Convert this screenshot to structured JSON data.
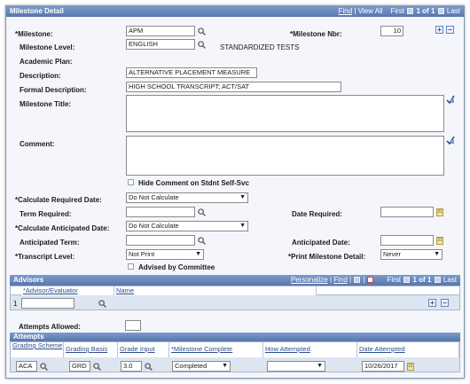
{
  "milestone_detail": {
    "title": "Milestone Detail",
    "nav": {
      "find": "Find",
      "view_all": "View All",
      "first": "First",
      "count": "1 of 1",
      "last": "Last",
      "sep": "|"
    },
    "milestone_label": "*Milestone:",
    "milestone_value": "APM",
    "milestone_nbr_label": "*Milestone Nbr:",
    "milestone_nbr_value": "10",
    "milestone_level_label": "Milestone Level:",
    "milestone_level_value": "ENGLISH",
    "milestone_level_desc": "STANDARDIZED TESTS",
    "academic_plan_label": "Academic Plan:",
    "description_label": "Description:",
    "description_value": "ALTERNATIVE PLACEMENT MEASURE",
    "formal_description_label": "Formal Description:",
    "formal_description_value": "HIGH SCHOOL TRANSCRIPT; ACT/SAT",
    "milestone_title_label": "Milestone Title:",
    "comment_label": "Comment:",
    "hide_comment_label": "Hide Comment on Stdnt Self-Svc",
    "calc_required_label": "*Calculate Required Date:",
    "calc_required_value": "Do Not Calculate",
    "term_required_label": "Term Required:",
    "date_required_label": "Date Required:",
    "calc_anticipated_label": "*Calculate Anticipated Date:",
    "calc_anticipated_value": "Do Not Calculate",
    "anticipated_term_label": "Anticipated Term:",
    "anticipated_date_label": "Anticipated Date:",
    "transcript_level_label": "*Transcript Level:",
    "transcript_level_value": "Not Print",
    "print_detail_label": "*Print Milestone Detail:",
    "print_detail_value": "Never",
    "advised_label": "Advised by Committee"
  },
  "advisors": {
    "title": "Advisors",
    "nav": {
      "personalize": "Personalize",
      "find": "Find",
      "first": "First",
      "count": "1 of 1",
      "last": "Last",
      "sep": "|"
    },
    "col_advisor": "*Advisor/Evaluator",
    "col_name": "Name",
    "row_num": "1"
  },
  "attempts_allowed_label": "Attempts Allowed:",
  "attempts": {
    "title": "Attempts",
    "col_grading_scheme": "Grading Scheme",
    "col_grading_basis": "Grading Basis",
    "col_grade_input": "Grade Input",
    "col_milestone_complete": "*Milestone Complete",
    "col_how_attempted": "How Attempted",
    "col_date_attempted": "Date Attempted",
    "grading_scheme": "ACA",
    "grading_basis": "GRD",
    "grade_input": "3.0",
    "milestone_complete": "Completed",
    "how_attempted": "",
    "date_attempted": "10/26/2017"
  }
}
